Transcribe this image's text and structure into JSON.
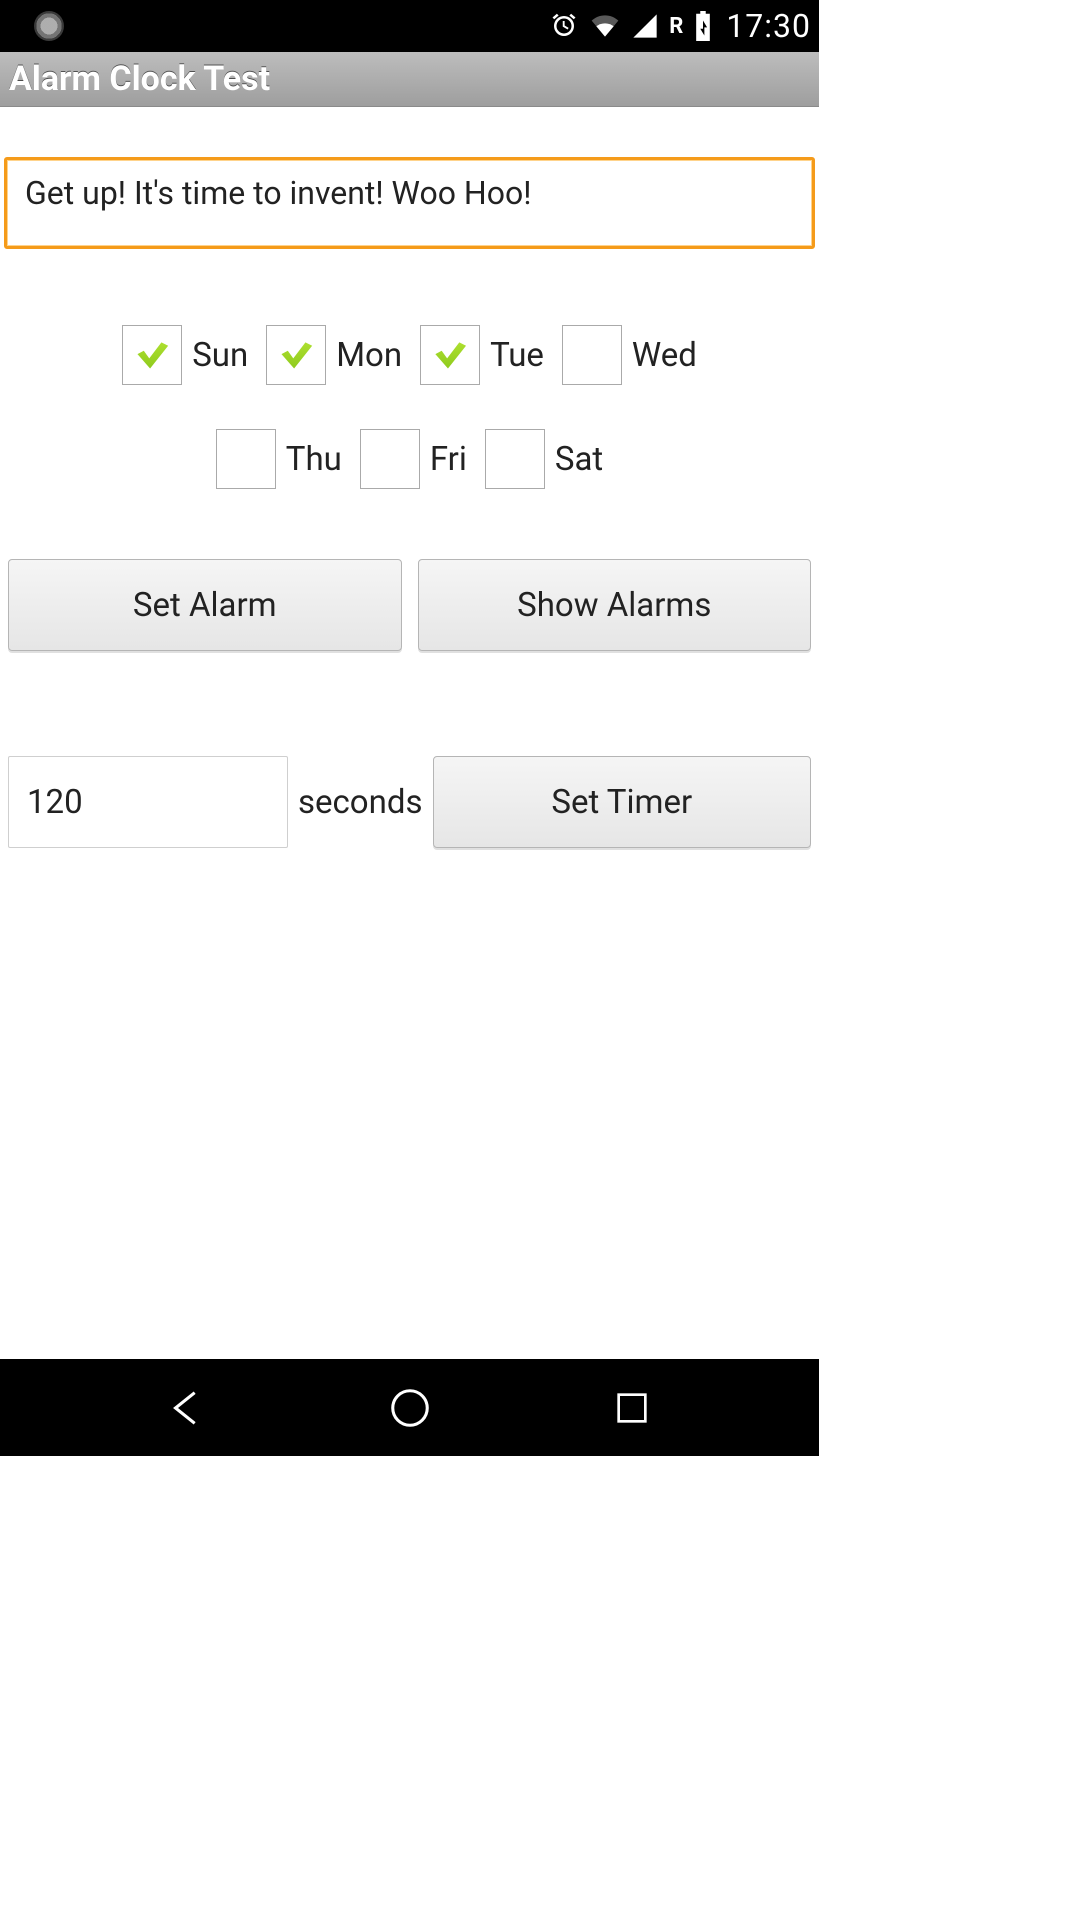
{
  "status": {
    "time": "17:30",
    "roaming": "R",
    "icons": {
      "spinner": "spinner-icon",
      "alarm": "alarm-icon",
      "wifi": "wifi-icon",
      "cell": "cell-signal-icon",
      "battery": "battery-charging-icon"
    }
  },
  "actionbar": {
    "title": "Alarm Clock Test"
  },
  "form": {
    "message_value": "Get up! It's time to invent! Woo Hoo!"
  },
  "days": [
    {
      "key": "sun",
      "label": "Sun",
      "checked": true
    },
    {
      "key": "mon",
      "label": "Mon",
      "checked": true
    },
    {
      "key": "tue",
      "label": "Tue",
      "checked": true
    },
    {
      "key": "wed",
      "label": "Wed",
      "checked": false
    },
    {
      "key": "thu",
      "label": "Thu",
      "checked": false
    },
    {
      "key": "fri",
      "label": "Fri",
      "checked": false
    },
    {
      "key": "sat",
      "label": "Sat",
      "checked": false
    }
  ],
  "buttons": {
    "set_alarm": "Set Alarm",
    "show_alarms": "Show Alarms",
    "set_timer": "Set Timer"
  },
  "timer": {
    "value": "120",
    "unit_label": "seconds"
  },
  "nav": {
    "back": "back-icon",
    "home": "home-icon",
    "recents": "recents-icon"
  }
}
